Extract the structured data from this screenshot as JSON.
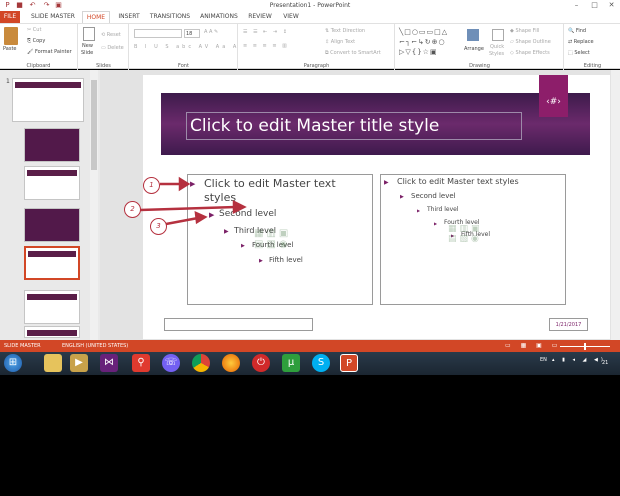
{
  "window": {
    "title": "Presentation1 - PowerPoint"
  },
  "tabs": [
    "FILE",
    "SLIDE MASTER",
    "HOME",
    "INSERT",
    "TRANSITIONS",
    "ANIMATIONS",
    "REVIEW",
    "VIEW"
  ],
  "ribbon": {
    "clipboard": {
      "label": "Clipboard",
      "paste": "Paste",
      "cut": "Cut",
      "copy": "Copy",
      "format_painter": "Format Painter"
    },
    "slides": {
      "label": "Slides",
      "new_slide": "New",
      "new_slide2": "Slide",
      "reset": "Reset",
      "delete": "Delete"
    },
    "font": {
      "label": "Font",
      "size": "18"
    },
    "paragraph": {
      "label": "Paragraph",
      "text_direction": "Text Direction",
      "align_text": "Align Text",
      "smartart": "Convert to SmartArt"
    },
    "drawing": {
      "label": "Drawing",
      "arrange": "Arrange",
      "quick_styles": "Quick",
      "quick_styles2": "Styles",
      "shape_fill": "Shape Fill",
      "shape_outline": "Shape Outline",
      "shape_effects": "Shape Effects"
    },
    "editing": {
      "label": "Editing",
      "find": "Find",
      "replace": "Replace",
      "select": "Select"
    }
  },
  "thumbnails": {
    "first_number": "1"
  },
  "slide": {
    "title": "Click to edit Master title style",
    "number": "‹#›",
    "left": {
      "l1": "Click to edit Master text",
      "l1b": "styles",
      "l2": "Second level",
      "l3": "Third level",
      "l4": "Fourth level",
      "l5": "Fifth level"
    },
    "right": {
      "l1": "Click to edit Master text styles",
      "l2": "Second level",
      "l3": "Third level",
      "l4": "Fourth level",
      "l5": "Fifth level"
    },
    "date": "1/21/2017"
  },
  "annotations": [
    "1",
    "2",
    "3"
  ],
  "statusbar": {
    "view": "SLIDE MASTER",
    "language": "ENGLISH (UNITED STATES)"
  },
  "taskbar": {
    "lang": "EN",
    "clock": "21"
  },
  "colors": {
    "accent": "#d24726",
    "slide_band": "#5a2160",
    "bullet": "#7a1f66"
  }
}
